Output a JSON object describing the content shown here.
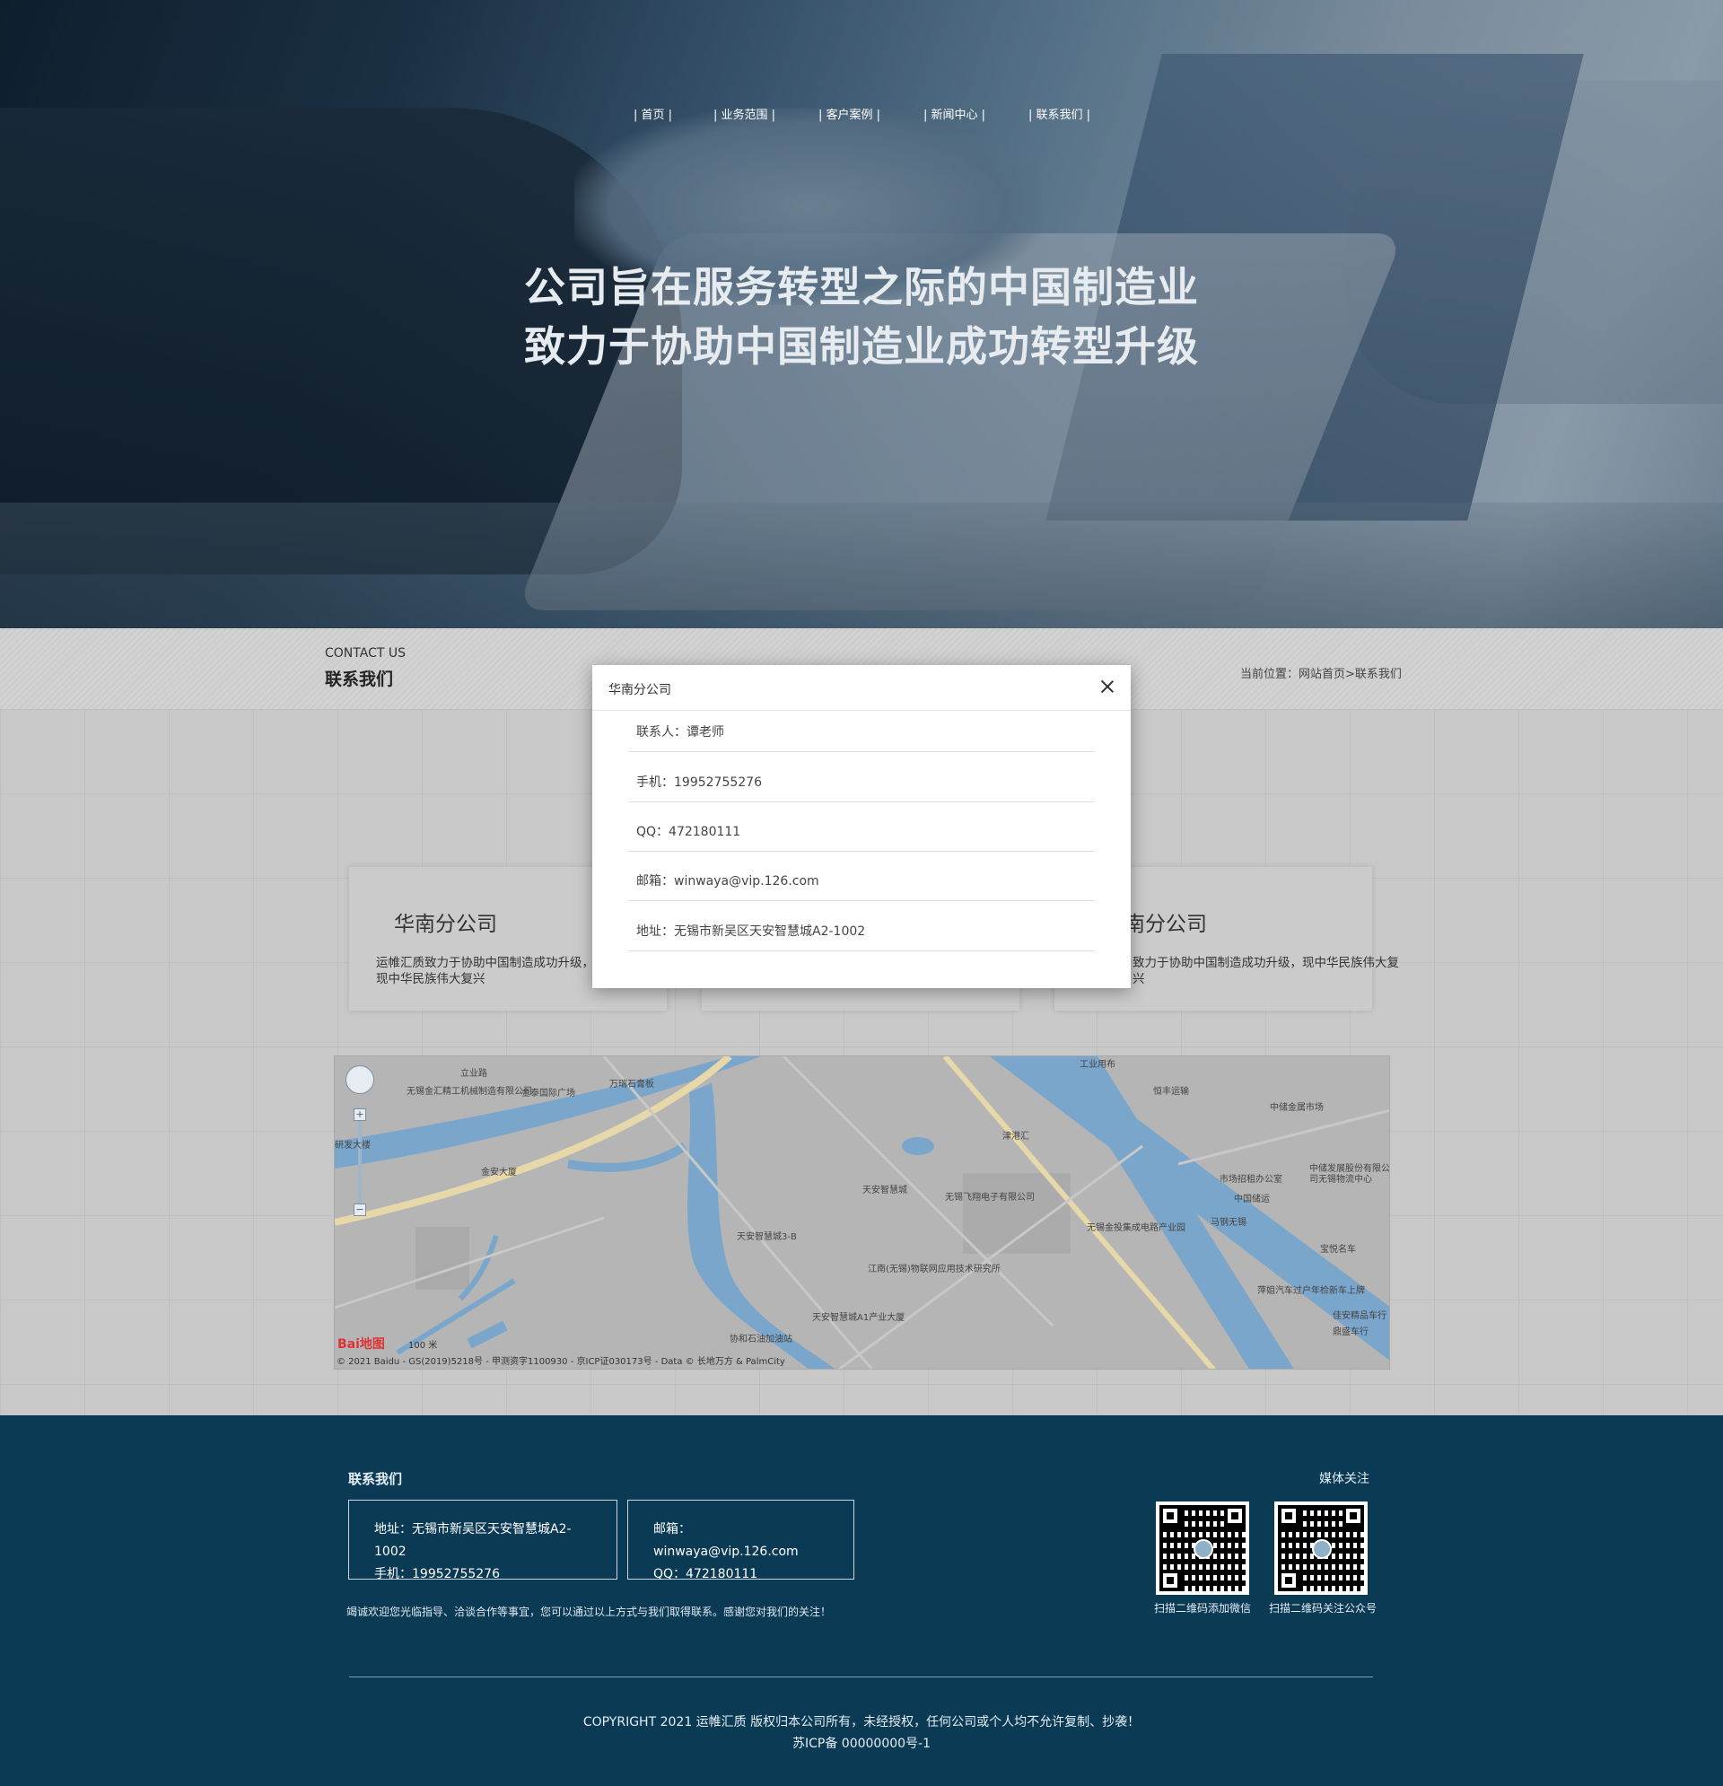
{
  "nav": {
    "items": [
      "| 首页 |",
      "| 业务范围 |",
      "| 客户案例 |",
      "| 新闻中心 |",
      "| 联系我们 |"
    ]
  },
  "hero": {
    "line1": "公司旨在服务转型之际的中国制造业",
    "line2": "致力于协助中国制造业成功转型升级"
  },
  "contact_header": {
    "en": "CONTACT US",
    "cn": "联系我们",
    "breadcrumb": "当前位置：网站首页>联系我们"
  },
  "cards": [
    {
      "title": "华南分公司",
      "desc": "运帷汇质致力于协助中国制造成功升级，致力于实现中华民族伟大复兴"
    },
    {
      "title": "",
      "desc": ""
    },
    {
      "title": "南分公司",
      "desc": "致力于协助中国制造成功升级，现中华民族伟大复兴"
    }
  ],
  "map": {
    "labels": [
      "立业路",
      "无锡金汇精工机械制造有限公司",
      "金泰国际广场",
      "万瑞石膏板",
      "金安大厦",
      "天安智慧城",
      "无锡飞翔电子有限公司",
      "天安智慧城3-B",
      "江南(无锡)物联网应用技术研究所",
      "天安智慧城A1产业大厦",
      "协和石油加油站",
      "恒丰运输",
      "中储金属市场",
      "市场招租办公室",
      "中储发展股份有限公司无锡物流中心",
      "中国储运",
      "马钢无锡",
      "宝悦名车",
      "无锡金投集成电路产业园",
      "津港汇",
      "萍姐汽车过户年检新车上牌",
      "佳安精品车行",
      "鼎盛车行",
      "工业用布",
      "研发大楼"
    ],
    "scale": "100 米",
    "logo": "Bai地图",
    "copyright": "© 2021 Baidu - GS(2019)5218号 - 甲测资字1100930 - 京ICP证030173号 - Data © 长地万方 & PalmCity"
  },
  "modal": {
    "title": "华南分公司",
    "rows": [
      "联系人：谭老师",
      "手机：19952755276",
      "QQ：472180111",
      "邮箱：winwaya@vip.126.com",
      "地址：无锡市新吴区天安智慧城A2-1002"
    ]
  },
  "footer": {
    "title": "联系我们",
    "box1": [
      "地址：无锡市新吴区天安智慧城A2-1002",
      "手机：19952755276"
    ],
    "box2": [
      "邮箱：winwaya@vip.126.com",
      "QQ：472180111"
    ],
    "note": "竭诚欢迎您光临指导、洽谈合作等事宜，您可以通过以上方式与我们取得联系。感谢您对我们的关注！",
    "media_title": "媒体关注",
    "qr1_caption": "扫描二维码添加微信",
    "qr2_caption": "扫描二维码关注公众号",
    "copyright1": "COPYRIGHT   2021  运帷汇质 版权归本公司所有，未经授权，任何公司或个人均不允许复制、抄袭！",
    "copyright2": "苏ICP备 00000000号-1"
  }
}
